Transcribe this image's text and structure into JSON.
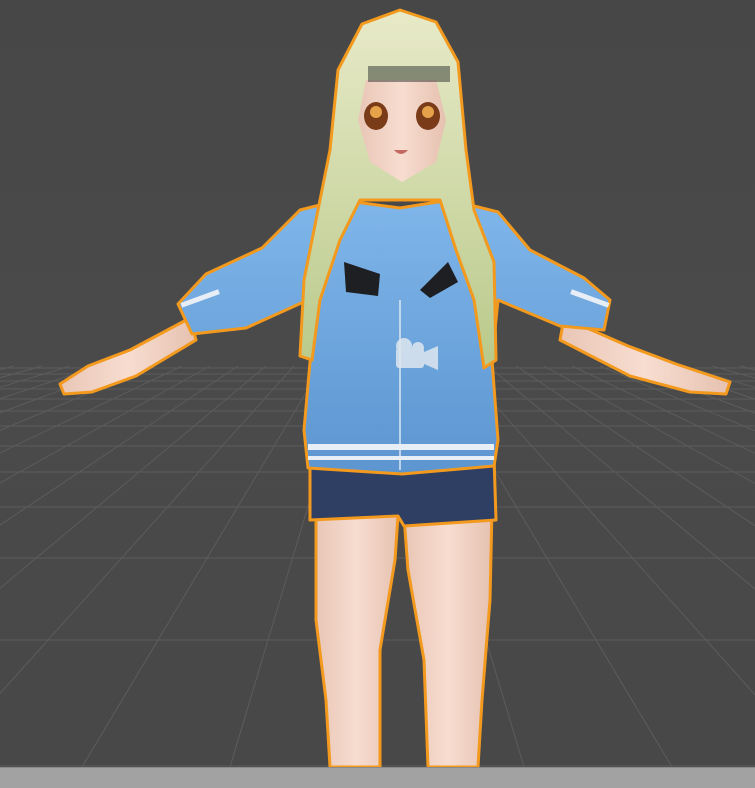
{
  "scene_view": {
    "background_color": "#4a4a4a",
    "grid_line_color": "#5c5c5c",
    "selection_outline_color": "#f39a1e",
    "gizmo": "camera-icon",
    "selected_object": "character-model"
  },
  "status_bar": {
    "color": "#a2a2a2"
  }
}
